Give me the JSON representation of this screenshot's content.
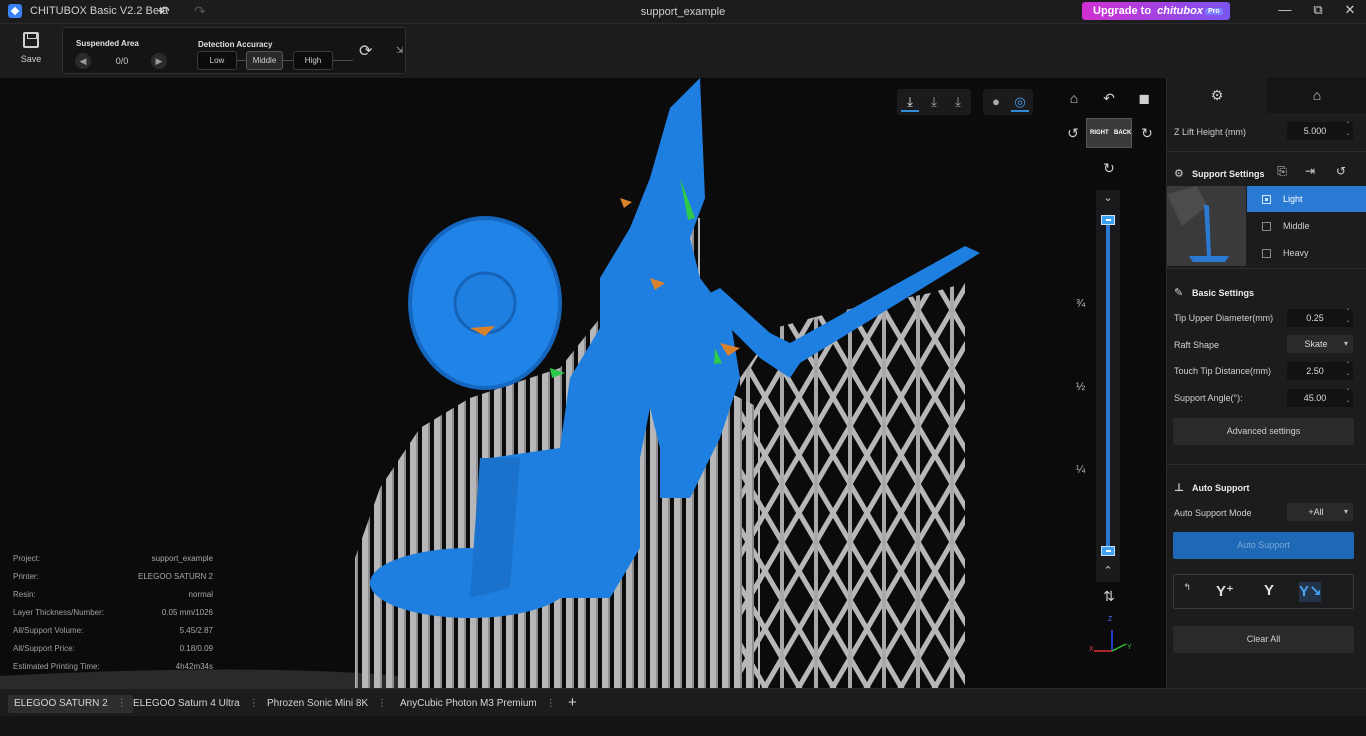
{
  "titlebar": {
    "app_title": "CHITUBOX Basic V2.2 Beta",
    "doc_title": "support_example",
    "upgrade_text": "Upgrade to",
    "upgrade_brand": "chitubox",
    "upgrade_badge": "Pro",
    "undo_icon": "↶",
    "redo_icon": "↷",
    "minimize": "—",
    "maximize": "⧉",
    "close": "✕"
  },
  "toolbar": {
    "save_label": "Save",
    "suspended_area_title": "Suspended Area",
    "suspended_count": "0/0",
    "prev_icon": "◀",
    "next_icon": "▶",
    "detection_accuracy_title": "Detection Accuracy",
    "accuracy_options": [
      "Low",
      "Middle",
      "High"
    ],
    "accuracy_selected": "Middle",
    "refresh_icon": "⟳",
    "collapse_icon": "⇲"
  },
  "viewport": {
    "view_icons": [
      "⤓",
      "⤓",
      "⤓"
    ],
    "shading_icons": [
      "●",
      "◎"
    ],
    "home_icon": "⌂",
    "reset_rotate_icon": "↶",
    "cube_icon": "◼",
    "rotate_left_icon": "↺",
    "rotate_right_icon": "↻",
    "rotate_down_icon": "↻",
    "cube_labels": {
      "right": "RIGHT",
      "back": "BACK"
    },
    "slider_up_icon": "⌄",
    "slider_down_icon": "⌃",
    "fractions": [
      "¾",
      "½",
      "¼"
    ],
    "swap_icon": "⇅",
    "axes": {
      "z": "Z",
      "x": "X",
      "y": "Y"
    },
    "model_colors": {
      "model": "#1e7fe0",
      "support": "#b7b7b9",
      "contact": "#2ec84a",
      "suspended": "#d9822b"
    }
  },
  "info": [
    {
      "k": "Project:",
      "v": "support_example"
    },
    {
      "k": "Printer:",
      "v": "ELEGOO SATURN 2"
    },
    {
      "k": "Resin:",
      "v": "normal"
    },
    {
      "k": "Layer Thickness/Number:",
      "v": "0.05 mm/1026"
    },
    {
      "k": "All/Support Volume:",
      "v": "5.45/2.87"
    },
    {
      "k": "All/Support Price:",
      "v": "0.18/0.09"
    },
    {
      "k": "Estimated Printing Time:",
      "v": "4h42m34s"
    }
  ],
  "panel": {
    "tab_icons": [
      "⚙",
      "⌂"
    ],
    "z_lift_label": "Z Lift Height (mm)",
    "z_lift_value": "5.000",
    "support_settings_title": "Support Settings",
    "support_settings_icons": [
      "⎘",
      "⇥",
      "↺"
    ],
    "presets": [
      {
        "label": "Light",
        "active": true
      },
      {
        "label": "Middle",
        "active": false
      },
      {
        "label": "Heavy",
        "active": false
      }
    ],
    "basic_settings_title": "Basic Settings",
    "fields": [
      {
        "label": "Tip Upper Diameter(mm)",
        "value": "0.25",
        "kind": "spin"
      },
      {
        "label": "Raft Shape",
        "value": "Skate",
        "kind": "drop"
      },
      {
        "label": "Touch Tip Distance(mm)",
        "value": "2.50",
        "kind": "spin"
      },
      {
        "label": "Support Angle(°):",
        "value": "45.00",
        "kind": "spin"
      }
    ],
    "advanced_button": "Advanced settings",
    "auto_support_title": "Auto Support",
    "auto_mode_label": "Auto Support Mode",
    "auto_mode_value": "+All",
    "auto_support_button": "Auto Support",
    "mode_icons": [
      "↰",
      "Y⁺",
      "Y",
      "Y↘"
    ],
    "clear_all_button": "Clear All"
  },
  "printer_tabs": [
    {
      "label": "ELEGOO SATURN 2",
      "active": true
    },
    {
      "label": "ELEGOO Saturn 4 Ultra",
      "active": false
    },
    {
      "label": "Phrozen Sonic Mini 8K",
      "active": false
    },
    {
      "label": "AnyCubic Photon M3 Premium",
      "active": false
    }
  ],
  "add_tab_icon": "+",
  "tab_menu_icon": "⋮"
}
